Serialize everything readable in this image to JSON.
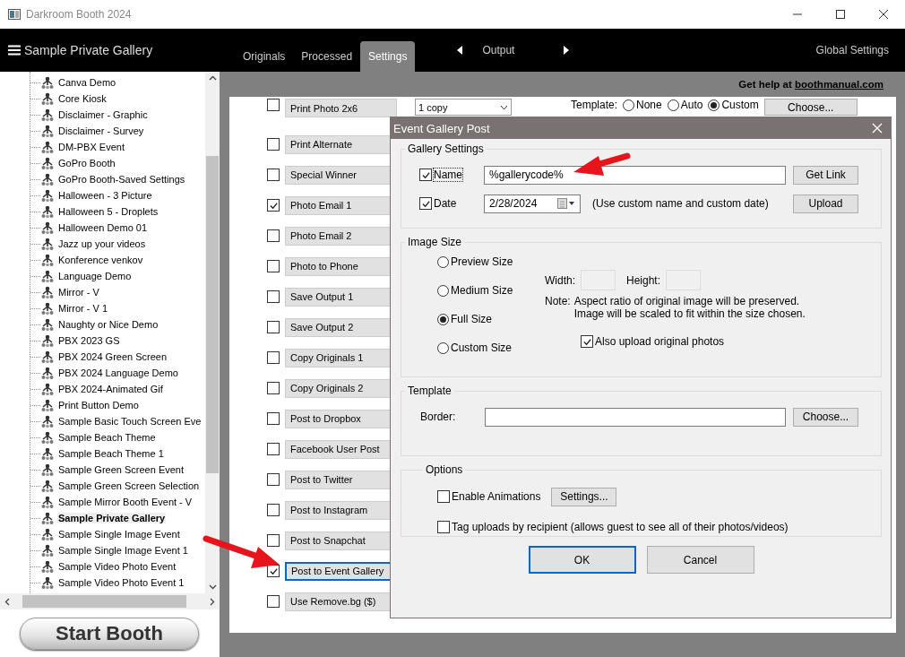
{
  "window": {
    "title": "Darkroom Booth 2024"
  },
  "nav": {
    "event_name": "Sample Private Gallery",
    "tabs": [
      {
        "label": "Originals",
        "selected": false
      },
      {
        "label": "Processed",
        "selected": false
      },
      {
        "label": "Settings",
        "selected": true
      }
    ],
    "output_label": "Output",
    "global_settings": "Global Settings"
  },
  "sidebar": {
    "items": [
      {
        "label": "Canva Demo",
        "selected": false
      },
      {
        "label": "Core Kiosk",
        "selected": false
      },
      {
        "label": "Disclaimer - Graphic",
        "selected": false
      },
      {
        "label": "Disclaimer - Survey",
        "selected": false
      },
      {
        "label": "DM-PBX Event",
        "selected": false
      },
      {
        "label": "GoPro Booth",
        "selected": false
      },
      {
        "label": "GoPro Booth-Saved Settings",
        "selected": false
      },
      {
        "label": "Halloween - 3  Picture",
        "selected": false
      },
      {
        "label": "Halloween 5 - Droplets",
        "selected": false
      },
      {
        "label": "Halloween Demo 01",
        "selected": false
      },
      {
        "label": "Jazz up your videos",
        "selected": false
      },
      {
        "label": "Konference venkov",
        "selected": false
      },
      {
        "label": "Language Demo",
        "selected": false
      },
      {
        "label": "Mirror - V",
        "selected": false
      },
      {
        "label": "Mirror - V  1",
        "selected": false
      },
      {
        "label": "Naughty or Nice Demo",
        "selected": false
      },
      {
        "label": "PBX 2023 GS",
        "selected": false
      },
      {
        "label": "PBX 2024 Green Screen",
        "selected": false
      },
      {
        "label": "PBX 2024 Language Demo",
        "selected": false
      },
      {
        "label": "PBX 2024-Animated Gif",
        "selected": false
      },
      {
        "label": "Print Button Demo",
        "selected": false
      },
      {
        "label": "Sample Basic Touch Screen Eve",
        "selected": false
      },
      {
        "label": "Sample Beach Theme",
        "selected": false
      },
      {
        "label": "Sample Beach Theme  1",
        "selected": false
      },
      {
        "label": "Sample Green Screen Event",
        "selected": false
      },
      {
        "label": "Sample Green Screen Selection",
        "selected": false
      },
      {
        "label": "Sample Mirror Booth Event - V",
        "selected": false
      },
      {
        "label": "Sample Private Gallery",
        "selected": true
      },
      {
        "label": "Sample Single Image Event",
        "selected": false
      },
      {
        "label": "Sample Single Image Event  1",
        "selected": false
      },
      {
        "label": "Sample Video Photo Event",
        "selected": false
      },
      {
        "label": "Sample Video Photo Event  1",
        "selected": false
      }
    ]
  },
  "start_button": "Start Booth",
  "help": {
    "text": "Get help at",
    "link": "boothmanual.com"
  },
  "print_options": {
    "copies": "1 copy",
    "template_label": "Template:",
    "template_options": [
      {
        "label": "None",
        "selected": false
      },
      {
        "label": "Auto",
        "selected": false
      },
      {
        "label": "Custom",
        "selected": true
      }
    ],
    "choose_button": "Choose..."
  },
  "outputs": [
    {
      "label": "Print Photo  2x6",
      "checked": false,
      "focused": false
    },
    {
      "label": "Print Alternate",
      "checked": false,
      "focused": false
    },
    {
      "label": "Special Winner",
      "checked": false,
      "focused": false
    },
    {
      "label": "Photo Email 1",
      "checked": true,
      "focused": false
    },
    {
      "label": "Photo Email 2",
      "checked": false,
      "focused": false
    },
    {
      "label": "Photo to Phone",
      "checked": false,
      "focused": false
    },
    {
      "label": "Save Output 1",
      "checked": false,
      "focused": false
    },
    {
      "label": "Save Output 2",
      "checked": false,
      "focused": false
    },
    {
      "label": "Copy Originals 1",
      "checked": false,
      "focused": false
    },
    {
      "label": "Copy Originals 2",
      "checked": false,
      "focused": false
    },
    {
      "label": "Post to Dropbox",
      "checked": false,
      "focused": false
    },
    {
      "label": "Facebook User Post",
      "checked": false,
      "focused": false
    },
    {
      "label": "Post to Twitter",
      "checked": false,
      "focused": false
    },
    {
      "label": "Post to Instagram",
      "checked": false,
      "focused": false
    },
    {
      "label": "Post to Snapchat",
      "checked": false,
      "focused": false
    },
    {
      "label": "Post to Event Gallery",
      "checked": true,
      "focused": true
    },
    {
      "label": "Use Remove.bg ($)",
      "checked": false,
      "focused": false
    }
  ],
  "dialog": {
    "title": "Event Gallery Post",
    "gallery_settings": {
      "legend": "Gallery Settings",
      "name": {
        "label": "Name",
        "checked": true,
        "value": "%gallerycode%"
      },
      "date": {
        "label": "Date",
        "checked": true,
        "value": "2/28/2024"
      },
      "note": "(Use custom name and custom date)",
      "get_link": "Get Link",
      "upload": "Upload"
    },
    "image_size": {
      "legend": "Image Size",
      "options": [
        {
          "label": "Preview Size",
          "selected": false
        },
        {
          "label": "Medium Size",
          "selected": false
        },
        {
          "label": "Full Size",
          "selected": true
        },
        {
          "label": "Custom Size",
          "selected": false
        }
      ],
      "width_label": "Width:",
      "height_label": "Height:",
      "note_label": "Note:",
      "note_lines": [
        "Aspect ratio of original image will be preserved.",
        "Image will be scaled to fit within the size chosen."
      ],
      "also_upload": {
        "label": "Also upload original photos",
        "checked": true
      }
    },
    "template": {
      "legend": "Template",
      "border_label": "Border:",
      "choose": "Choose..."
    },
    "options": {
      "legend": "Options",
      "enable_animations": {
        "label": "Enable Animations",
        "checked": false
      },
      "settings_button": "Settings...",
      "tag_uploads": {
        "label": "Tag uploads by recipient (allows guest to see all of their photos/videos)",
        "checked": false
      }
    },
    "buttons": [
      {
        "label": "OK",
        "default": true
      },
      {
        "label": "Cancel",
        "default": false
      }
    ]
  }
}
